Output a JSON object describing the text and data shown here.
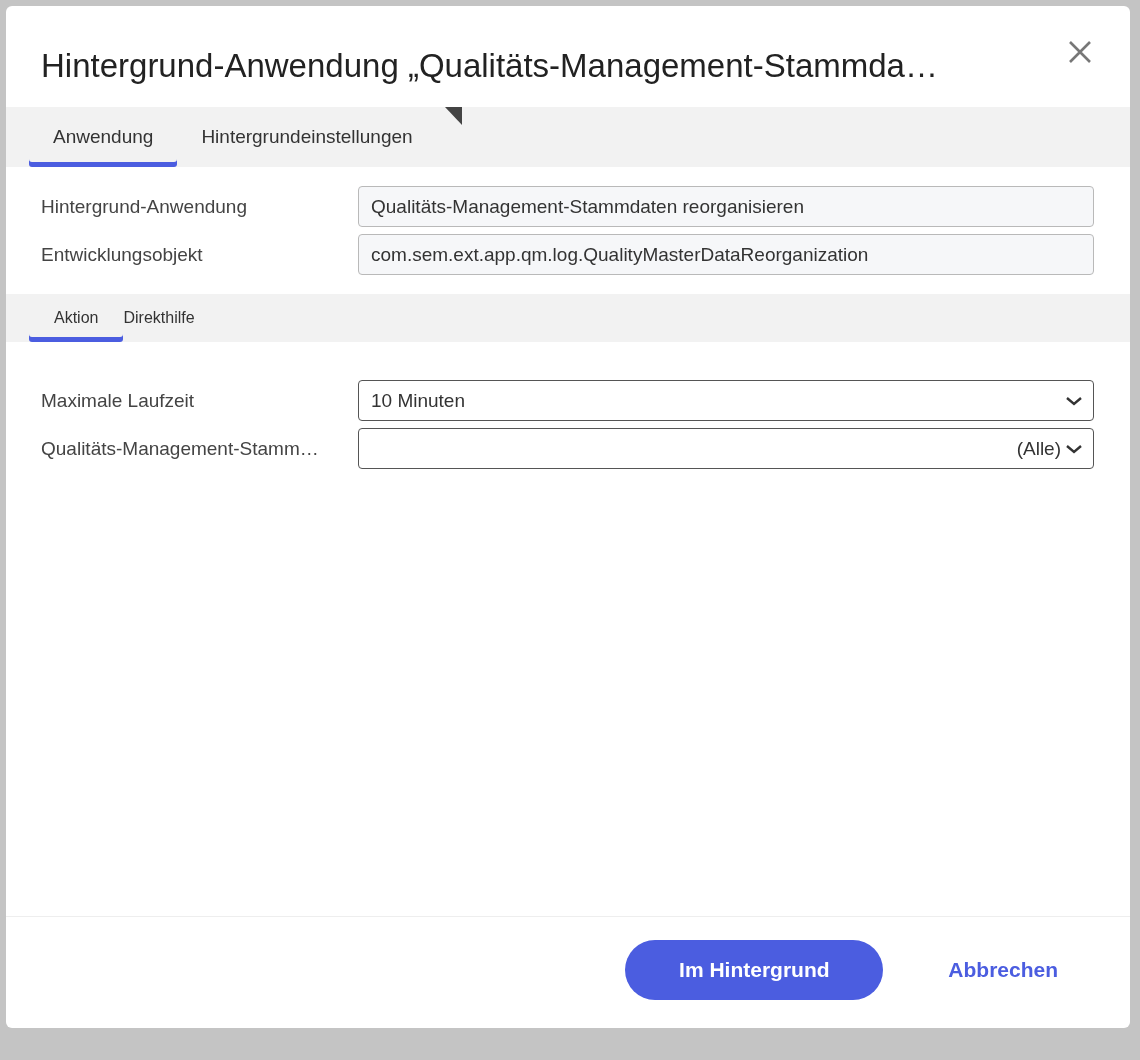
{
  "dialog": {
    "title": "Hintergrund-Anwendung „Qualitäts-Management-Stammda…"
  },
  "tabs": [
    {
      "label": "Anwendung",
      "selected": true
    },
    {
      "label": "Hintergrundeinstellungen",
      "selected": false
    }
  ],
  "info_fields": [
    {
      "label": "Hintergrund-Anwendung",
      "value": "Qualitäts-Management-Stammdaten reorganisieren",
      "kind": "readonly"
    },
    {
      "label": "Entwicklungsobjekt",
      "value": "com.sem.ext.app.qm.log.QualityMasterDataReorganization",
      "kind": "readonly"
    }
  ],
  "subtabs": [
    {
      "label": "Aktion",
      "selected": true
    },
    {
      "label": "Direkthilfe",
      "selected": false
    }
  ],
  "parameters": [
    {
      "label": "Maximale Laufzeit",
      "value": "10 Minuten",
      "kind": "select"
    },
    {
      "label": "Qualitäts-Management-Stamm…",
      "value": "(Alle)",
      "kind": "select-right"
    }
  ],
  "buttons": [
    {
      "label": "Im Hintergrund",
      "kind": "primary"
    },
    {
      "label": "Abbrechen",
      "kind": "text"
    }
  ]
}
